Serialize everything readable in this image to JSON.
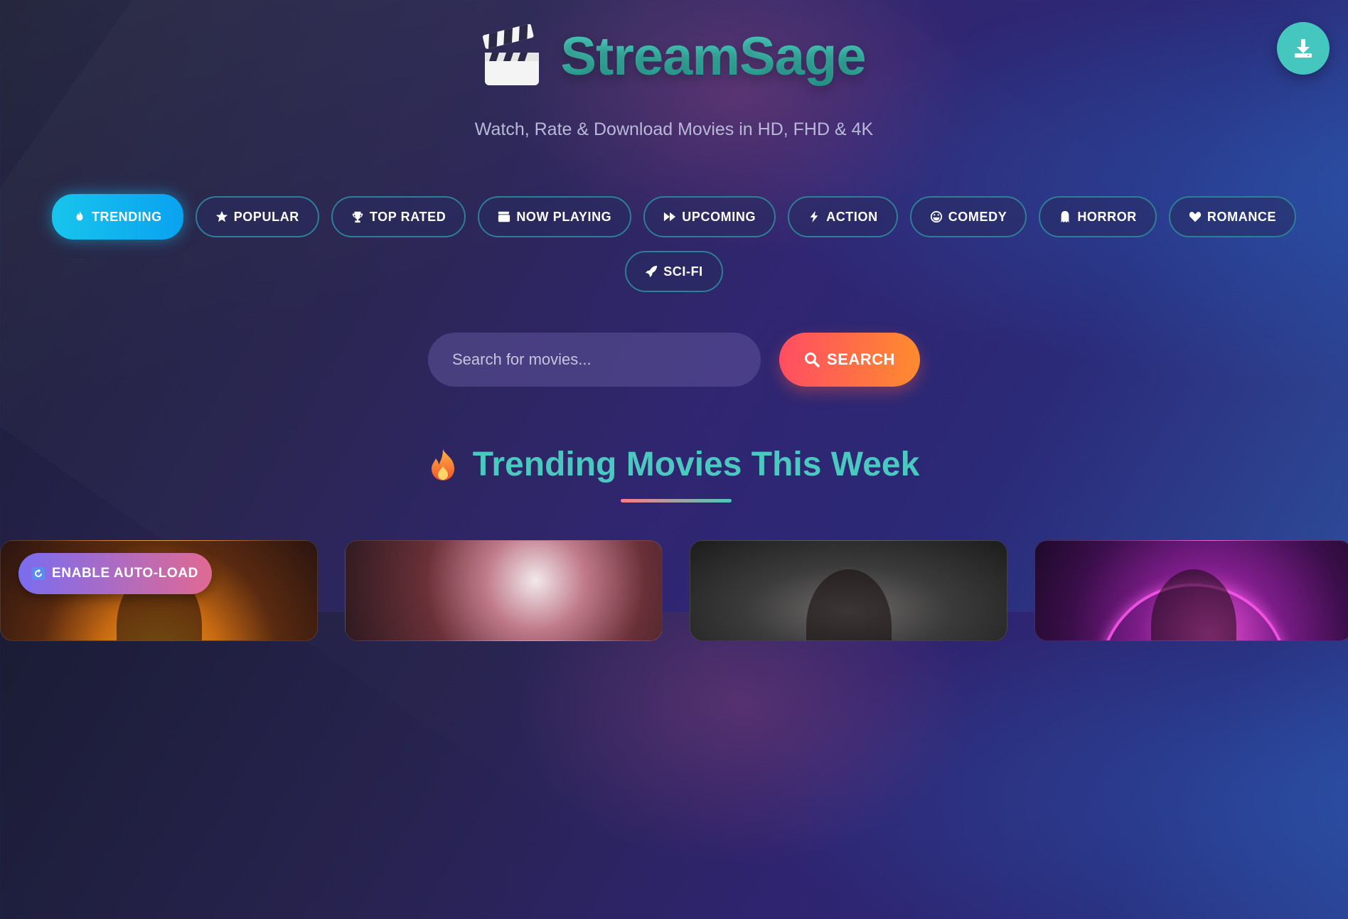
{
  "brand": {
    "title": "StreamSage",
    "tagline": "Watch, Rate & Download Movies in HD, FHD & 4K",
    "icon": "clapperboard-icon"
  },
  "fab": {
    "icon": "download-icon"
  },
  "categories": [
    {
      "label": "TRENDING",
      "icon": "fire-icon",
      "active": true
    },
    {
      "label": "POPULAR",
      "icon": "star-icon"
    },
    {
      "label": "TOP RATED",
      "icon": "trophy-icon"
    },
    {
      "label": "NOW PLAYING",
      "icon": "film-icon"
    },
    {
      "label": "UPCOMING",
      "icon": "fast-forward-icon"
    },
    {
      "label": "ACTION",
      "icon": "bolt-icon"
    },
    {
      "label": "COMEDY",
      "icon": "laugh-icon"
    },
    {
      "label": "HORROR",
      "icon": "ghost-icon"
    },
    {
      "label": "ROMANCE",
      "icon": "heart-icon"
    },
    {
      "label": "SCI-FI",
      "icon": "rocket-icon"
    }
  ],
  "search": {
    "placeholder": "Search for movies...",
    "button_label": "SEARCH",
    "button_icon": "search-icon"
  },
  "section": {
    "title": "Trending Movies This Week",
    "icon": "fire-emoji-icon"
  },
  "autoload": {
    "label": "ENABLE AUTO-LOAD",
    "icon": "refresh-icon"
  },
  "colors": {
    "accent": "#45c7c0",
    "active_pill": "#0aa2f0",
    "search_button": "#ff6a45"
  }
}
